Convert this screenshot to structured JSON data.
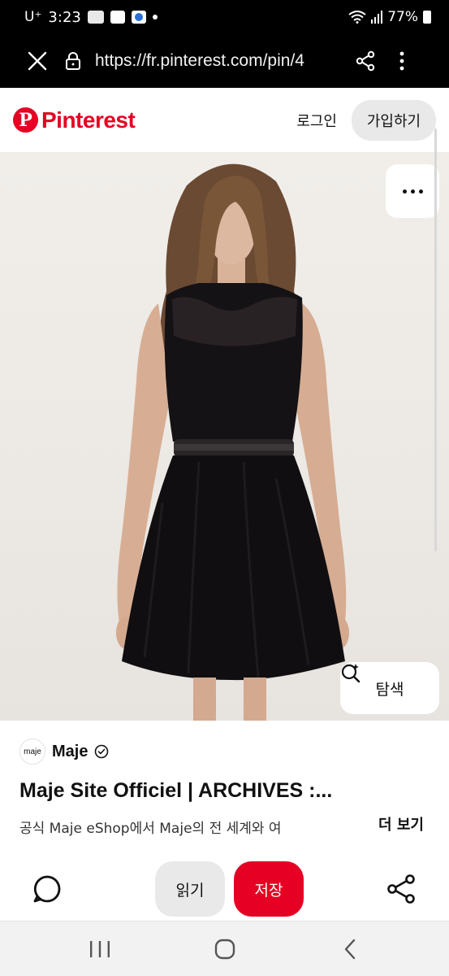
{
  "status_bar": {
    "carrier": "U⁺",
    "time": "3:23",
    "battery": "77%",
    "notification_icons": [
      "webtoon-icon",
      "square-icon",
      "paw-icon",
      "dot-icon"
    ]
  },
  "browser": {
    "url": "https://fr.pinterest.com/pin/4"
  },
  "header": {
    "logo_text": "Pinterest",
    "login_label": "로그인",
    "signup_label": "가입하기"
  },
  "pin": {
    "image_alt": "model wearing black sleeveless dress",
    "explore_label": "탐색",
    "creator_avatar_text": "maje",
    "creator_name": "Maje",
    "title": "Maje Site Officiel | ARCHIVES :...",
    "description": "공식 Maje eShop에서 Maje의 전 세계와 여",
    "more_label": "더 보기"
  },
  "actions": {
    "read_label": "읽기",
    "save_label": "저장"
  },
  "colors": {
    "brand_red": "#e60023",
    "button_gray": "#e9e9e9",
    "chrome_black": "#000000"
  }
}
